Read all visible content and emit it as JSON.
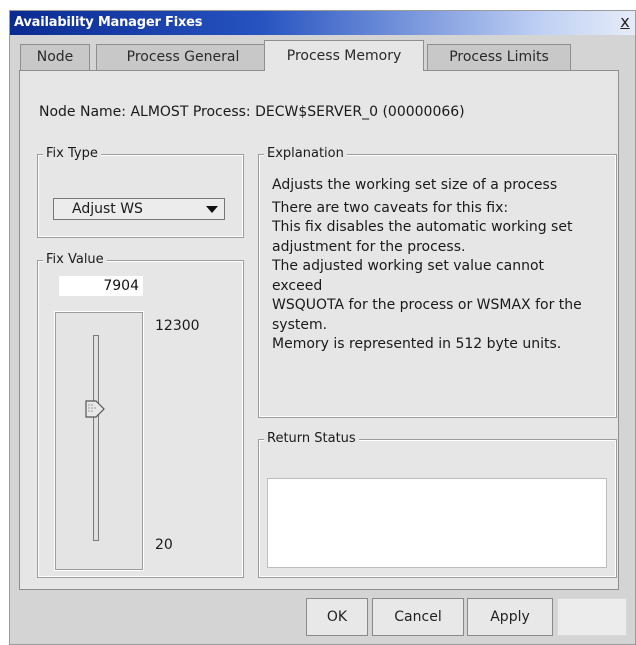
{
  "window": {
    "title": "Availability Manager Fixes",
    "close_glyph": "x"
  },
  "tabs": [
    {
      "label": "Node",
      "active": false
    },
    {
      "label": "Process General",
      "active": false
    },
    {
      "label": "Process Memory",
      "active": true
    },
    {
      "label": "Process Limits",
      "active": false
    }
  ],
  "node_info": "Node Name: ALMOST Process: DECW$SERVER_0 (00000066)",
  "fix_type": {
    "label": "Fix Type",
    "selected": "Adjust WS"
  },
  "fix_value": {
    "label": "Fix Value",
    "value": "7904",
    "slider_max": "12300",
    "slider_min": "20",
    "slider_level": 0.64
  },
  "explanation": {
    "label": "Explanation",
    "lines": [
      "Adjusts the working set size of a process",
      "There are two caveats for this fix:",
      "This fix disables the automatic working set",
      "adjustment for the process.",
      "The adjusted working set value cannot",
      "exceed",
      "WSQUOTA for the process or WSMAX for the",
      "system.",
      "Memory is represented in 512 byte units."
    ]
  },
  "return_status": {
    "label": "Return Status",
    "text": ""
  },
  "buttons": {
    "ok": "OK",
    "cancel": "Cancel",
    "apply": "Apply",
    "extra": ""
  },
  "colors": {
    "title_start": "#0b2a92",
    "title_end": "#e6ecf8",
    "panel": "#e6e6e6"
  }
}
